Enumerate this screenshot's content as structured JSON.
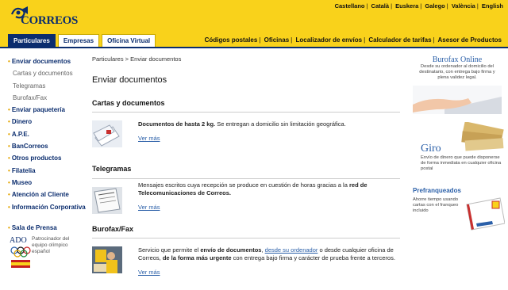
{
  "brand": {
    "name": "CORREOS"
  },
  "languages": [
    "Castellano",
    "Català",
    "Euskera",
    "Galego",
    "València",
    "English"
  ],
  "tabs": [
    {
      "label": "Particulares",
      "active": true
    },
    {
      "label": "Empresas",
      "active": false
    },
    {
      "label": "Oficina Virtual",
      "active": false
    }
  ],
  "toplinks": [
    "Códigos postales",
    "Oficinas",
    "Localizador de envíos",
    "Calculador de tarifas",
    "Asesor de Productos"
  ],
  "sidebar": {
    "items": [
      {
        "label": "Enviar documentos",
        "type": "main"
      },
      {
        "label": "Cartas y documentos",
        "type": "sub"
      },
      {
        "label": "Telegramas",
        "type": "sub"
      },
      {
        "label": "Burofax/Fax",
        "type": "sub"
      },
      {
        "label": "Enviar paquetería",
        "type": "main"
      },
      {
        "label": "Dinero",
        "type": "main"
      },
      {
        "label": "A.P.E.",
        "type": "main"
      },
      {
        "label": "BanCorreos",
        "type": "main"
      },
      {
        "label": "Otros productos",
        "type": "main"
      },
      {
        "label": "Filatelia",
        "type": "main"
      },
      {
        "label": "Museo",
        "type": "main"
      },
      {
        "label": "Atención al Cliente",
        "type": "main"
      },
      {
        "label": "Información Corporativa",
        "type": "main"
      }
    ],
    "press": "Sala de Prensa",
    "sponsor": {
      "logo": "ADO",
      "text": "Patrocinador del equipo olímpico español"
    }
  },
  "breadcrumb": "Particulares > Enviar documentos",
  "page_title": "Enviar documentos",
  "sections": [
    {
      "title": "Cartas y documentos",
      "bold_lead": "Documentos de hasta 2 kg.",
      "text": " Se entregan a domicilio sin limitación geográfica.",
      "more": "Ver más"
    },
    {
      "title": "Telegramas",
      "text_a": "Mensajes escritos cuya recepción se produce en cuestión de horas gracias a la ",
      "bold": "red de Telecomunicaciones de Correos.",
      "more": "Ver más"
    },
    {
      "title": "Burofax/Fax",
      "text_a": "Servicio que permite el ",
      "bold_a": "envío de documentos",
      "text_b": ", ",
      "link": "desde su ordenador",
      "text_c": " o desde cualquier oficina de Correos, ",
      "bold_b": "de la forma más urgente",
      "text_d": " con entrega bajo firma y carácter de prueba frente a terceros.",
      "more": "Ver más"
    }
  ],
  "promos": [
    {
      "title": "Burofax Online",
      "text": "Desde su ordenador al domicilio del destinatario, con entrega bajo firma y plena validez legal."
    },
    {
      "title": "Giro",
      "text": "Envío de dinero que puede disponerse de forma inmediata en cualquier oficina postal"
    },
    {
      "title": "Prefranqueados",
      "text": "Ahorre tiempo usando cartas con el franqueo incluido"
    }
  ],
  "colors": {
    "brand_yellow": "#f9d21b",
    "brand_blue": "#0b2d6e",
    "link_blue": "#2a5fa8"
  }
}
